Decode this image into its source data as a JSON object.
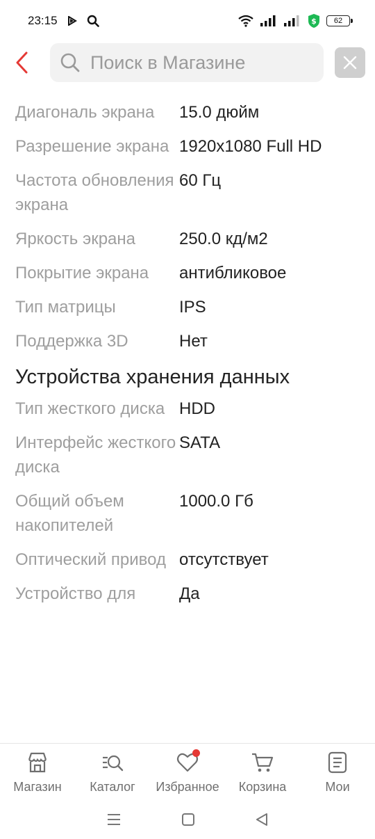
{
  "status_bar": {
    "time": "23:15",
    "battery": "62"
  },
  "search": {
    "placeholder": "Поиск в Магазине"
  },
  "specs": {
    "display": [
      {
        "key": "Диагональ экрана",
        "value": "15.0 дюйм"
      },
      {
        "key": "Разрешение экрана",
        "value": "1920x1080 Full HD"
      },
      {
        "key": "Частота обновления экрана",
        "value": "60 Гц"
      },
      {
        "key": "Яркость экрана",
        "value": "250.0 кд/м2"
      },
      {
        "key": "Покрытие экрана",
        "value": "антибликовое"
      },
      {
        "key": "Тип матрицы",
        "value": "IPS"
      },
      {
        "key": "Поддержка 3D",
        "value": "Нет"
      }
    ],
    "storage_title": "Устройства хранения данных",
    "storage": [
      {
        "key": "Тип жесткого диска",
        "value": "HDD"
      },
      {
        "key": "Интерфейс жесткого диска",
        "value": "SATA"
      },
      {
        "key": "Общий объем накопителей",
        "value": "1000.0 Гб"
      },
      {
        "key": "Оптический привод",
        "value": "отсутствует"
      },
      {
        "key": "Устройство для",
        "value": "Да"
      }
    ]
  },
  "bottom_nav": [
    {
      "label": "Магазин",
      "icon": "store-icon"
    },
    {
      "label": "Каталог",
      "icon": "catalog-search-icon"
    },
    {
      "label": "Избранное",
      "icon": "heart-icon"
    },
    {
      "label": "Корзина",
      "icon": "cart-icon"
    },
    {
      "label": "Мои",
      "icon": "orders-icon"
    }
  ],
  "colors": {
    "accent": "#e53935",
    "key_text": "#9e9e9e",
    "value_text": "#222222"
  }
}
